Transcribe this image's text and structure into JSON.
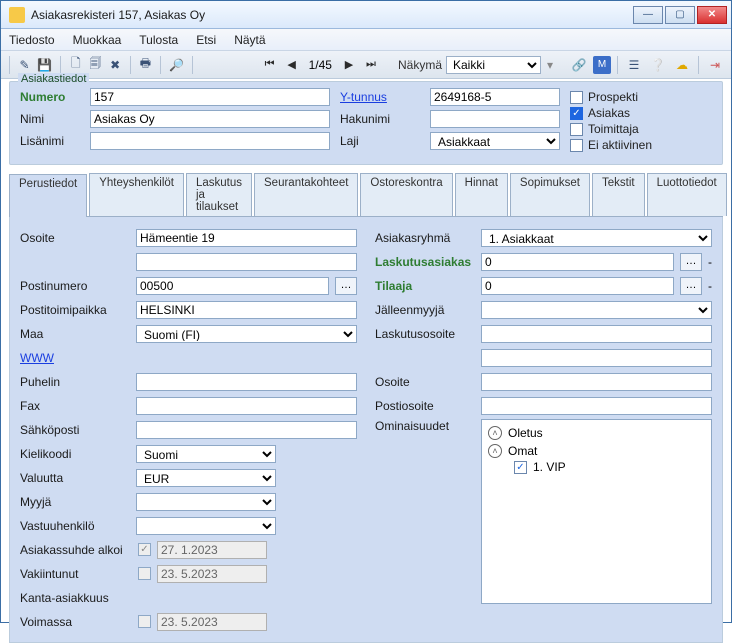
{
  "titlebar": {
    "text": "Asiakasrekisteri 157, Asiakas Oy"
  },
  "menu": {
    "tiedosto": "Tiedosto",
    "muokkaa": "Muokkaa",
    "tulosta": "Tulosta",
    "etsi": "Etsi",
    "nayta": "Näytä"
  },
  "nav": {
    "pos": "1/45",
    "view_label": "Näkymä",
    "view_value": "Kaikki"
  },
  "top": {
    "legend": "Asiakastiedot",
    "numero_label": "Numero",
    "numero": "157",
    "nimi_label": "Nimi",
    "nimi": "Asiakas Oy",
    "lisanimi_label": "Lisänimi",
    "lisanimi": "",
    "ytunnus_label": "Y-tunnus",
    "ytunnus": "2649168-5",
    "hakunimi_label": "Hakunimi",
    "hakunimi": "",
    "laji_label": "Laji",
    "laji": "Asiakkaat",
    "chk": {
      "prospekti": "Prospekti",
      "asiakas": "Asiakas",
      "toimittaja": "Toimittaja",
      "ei_aktiivinen": "Ei aktiivinen"
    }
  },
  "tabs": {
    "perustiedot": "Perustiedot",
    "yhteyshenkilot": "Yhteyshenkilöt",
    "laskutus": "Laskutus ja tilaukset",
    "seuranta": "Seurantakohteet",
    "ostoreskontra": "Ostoreskontra",
    "hinnat": "Hinnat",
    "sopimukset": "Sopimukset",
    "tekstit": "Tekstit",
    "luottotiedot": "Luottotiedot"
  },
  "left": {
    "osoite_label": "Osoite",
    "osoite": "Hämeentie 19",
    "osoite2": "",
    "postinumero_label": "Postinumero",
    "postinumero": "00500",
    "postitoimipaikka_label": "Postitoimipaikka",
    "postitoimipaikka": "HELSINKI",
    "maa_label": "Maa",
    "maa": "Suomi (FI)",
    "www_label": "WWW",
    "puhelin_label": "Puhelin",
    "puhelin": "",
    "fax_label": "Fax",
    "fax": "",
    "sahkoposti_label": "Sähköposti",
    "sahkoposti": "",
    "kielikoodi_label": "Kielikoodi",
    "kielikoodi": "Suomi",
    "valuutta_label": "Valuutta",
    "valuutta": "EUR",
    "myyja_label": "Myyjä",
    "myyja": "",
    "vastuu_label": "Vastuuhenkilö",
    "vastuu": "",
    "asuhde_label": "Asiakassuhde alkoi",
    "asuhde": "27. 1.2023",
    "vakiintunut_label": "Vakiintunut",
    "vakiintunut": "23. 5.2023",
    "kanta_label": "Kanta-asiakkuus",
    "voimassa_label": "Voimassa",
    "voimassa": "23. 5.2023"
  },
  "right": {
    "asiakasryhma_label": "Asiakasryhmä",
    "asiakasryhma": "1. Asiakkaat",
    "laskutusasiakas_label": "Laskutusasiakas",
    "laskutusasiakas": "0",
    "dash": "-",
    "tilaaja_label": "Tilaaja",
    "tilaaja": "0",
    "jalleenmyyja_label": "Jälleenmyyjä",
    "jalleenmyyja": "",
    "laskutusosoite_label": "Laskutusosoite",
    "laskutusosoite": "",
    "laskutusosoite2": "",
    "osoite_label": "Osoite",
    "osoite": "",
    "postiosoite_label": "Postiosoite",
    "postiosoite": "",
    "ominaisuudet_label": "Ominaisuudet",
    "tree": {
      "oletus": "Oletus",
      "omat": "Omat",
      "vip": "1. VIP"
    }
  }
}
